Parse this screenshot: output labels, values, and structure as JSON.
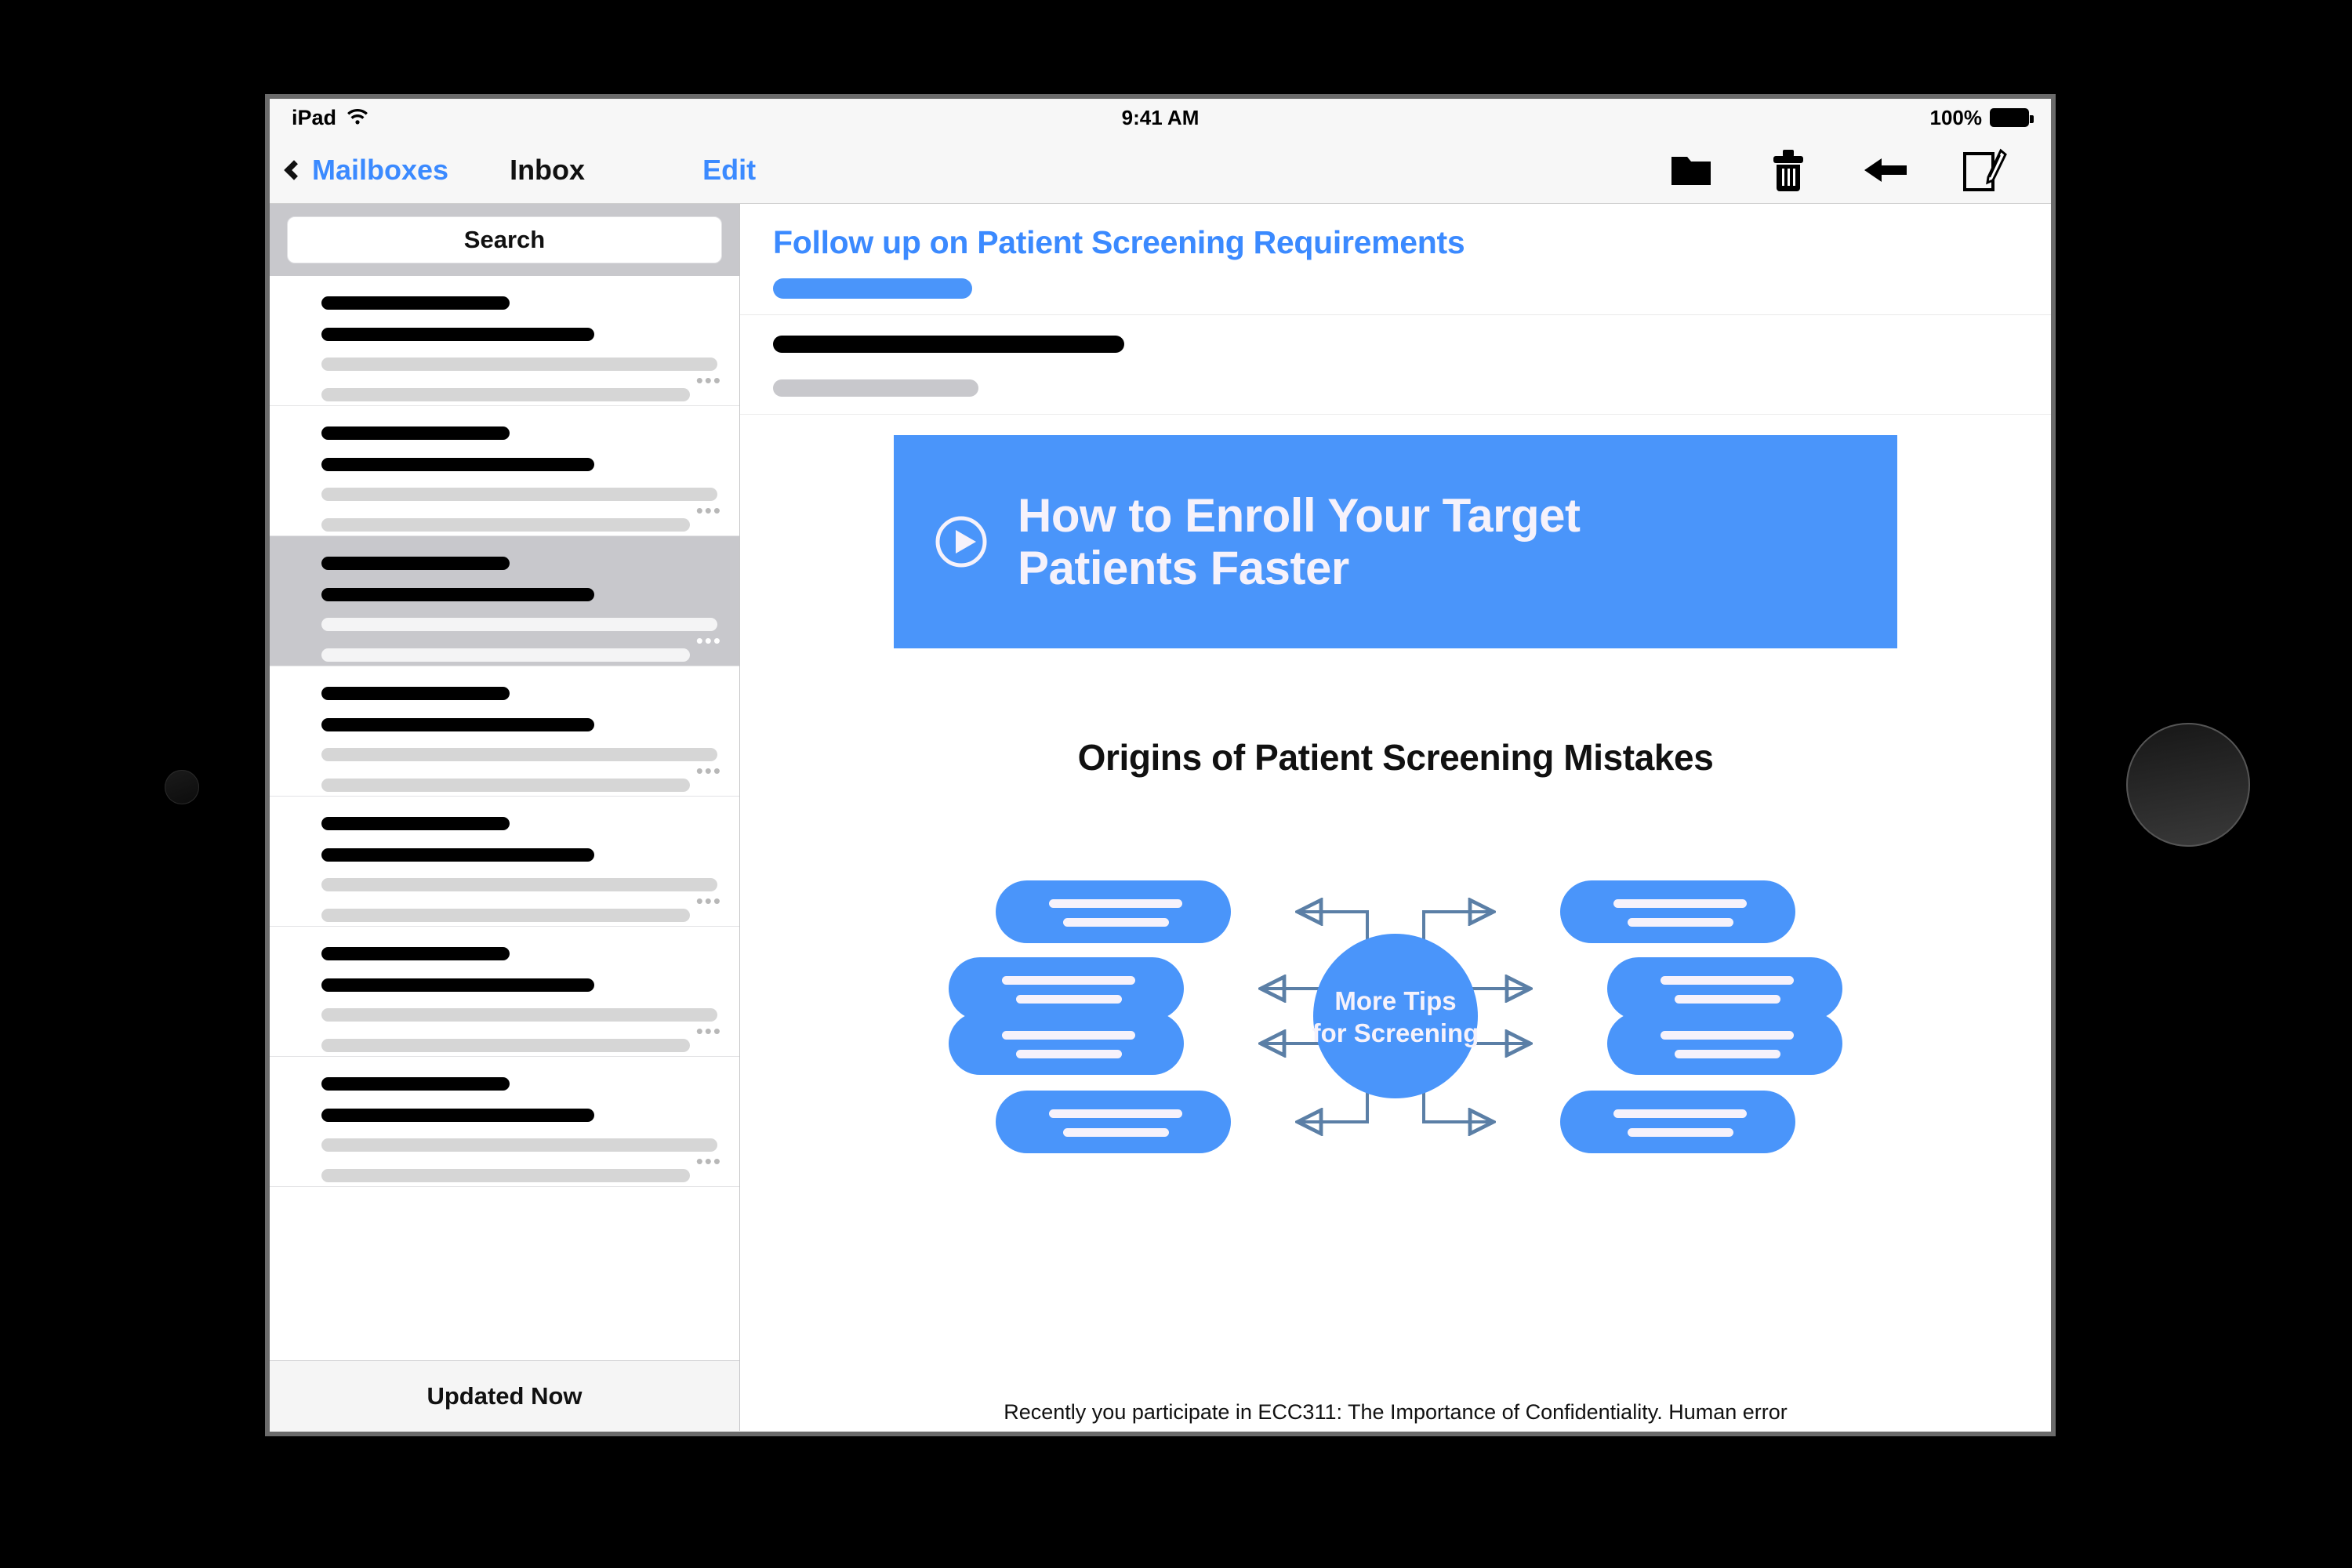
{
  "status_bar": {
    "device_label": "iPad",
    "wifi_icon": "wifi-icon",
    "time": "9:41 AM",
    "battery_percent": "100%",
    "battery_icon": "battery-full-icon"
  },
  "nav_bar": {
    "back_icon": "chevron-left-icon",
    "back_label": "Mailboxes",
    "title": "Inbox",
    "edit_label": "Edit",
    "actions": [
      {
        "name": "move-to-folder-button",
        "icon": "folder-icon"
      },
      {
        "name": "delete-button",
        "icon": "trash-icon"
      },
      {
        "name": "reply-button",
        "icon": "reply-arrow-icon"
      },
      {
        "name": "compose-button",
        "icon": "compose-pencil-icon"
      }
    ]
  },
  "sidebar": {
    "search": {
      "placeholder": "Search",
      "value": ""
    },
    "rows": [
      {
        "selected": false
      },
      {
        "selected": false
      },
      {
        "selected": true
      },
      {
        "selected": false
      },
      {
        "selected": false
      },
      {
        "selected": false
      },
      {
        "selected": false
      }
    ],
    "ellipsis": "•••",
    "footer_status": "Updated Now"
  },
  "message": {
    "subject": "Follow up on Patient Screening Requirements",
    "video_banner": {
      "play_icon": "play-circle-icon",
      "title_line_1": "How to Enroll Your Target",
      "title_line_2": "Patients Faster"
    },
    "diagram": {
      "heading": "Origins of Patient Screening Mistakes",
      "center_line_1": "More Tips",
      "center_line_2": "for Screening",
      "nodes": [
        {
          "position": "top-left"
        },
        {
          "position": "top-right"
        },
        {
          "position": "mid-upper-left"
        },
        {
          "position": "mid-upper-right"
        },
        {
          "position": "mid-lower-left"
        },
        {
          "position": "mid-lower-right"
        },
        {
          "position": "bottom-left"
        },
        {
          "position": "bottom-right"
        }
      ]
    },
    "footer_text": "Recently you participate in ECC311: The Importance of Confidentiality. Human error"
  },
  "colors": {
    "accent_blue": "#4a95fa",
    "link_blue": "#3b8aff",
    "arrow_blue": "#5b7fa6",
    "selected_row": "#c8c8cc",
    "placeholder_gray": "#d6d6d6"
  }
}
